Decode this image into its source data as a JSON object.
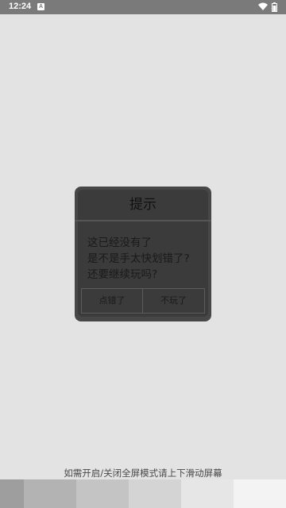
{
  "status_bar": {
    "time": "12:24",
    "notification_icon_letter": "A",
    "icons": [
      "wifi-icon",
      "battery-icon"
    ]
  },
  "dialog": {
    "title": "提示",
    "message_lines": [
      "这已经没有了",
      "是不是手太快划错了?",
      "还要继续玩吗?"
    ],
    "buttons": {
      "misclick_label": "点错了",
      "quit_label": "不玩了"
    }
  },
  "hint_text": "如需开启/关闭全屏模式请上下滑动屏幕",
  "colors": {
    "background": "#e3e3e3",
    "status_bar": "#7a7a7a",
    "dialog_frame": "#474747",
    "dialog_panel": "#3b3b3b",
    "swatches": [
      "#9e9e9e",
      "#b3b3b3",
      "#c4c4c4",
      "#d4d4d4",
      "#e6e6e6",
      "#f3f3f3"
    ]
  }
}
